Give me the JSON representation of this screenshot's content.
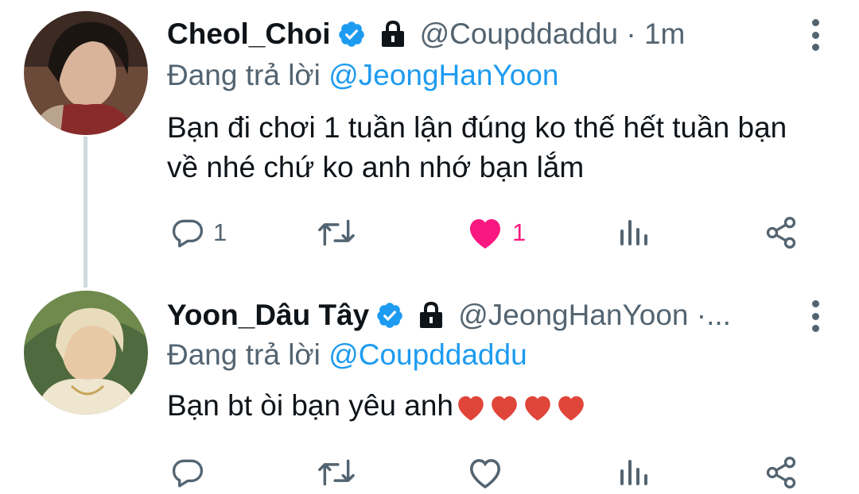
{
  "tweets": [
    {
      "display_name": "Cheol_Choi",
      "handle": "@Coupddaddu",
      "time": "1m",
      "replying_prefix": "Đang trả lời",
      "replying_to": "@JeongHanYoon",
      "text": "Bạn đi chơi 1 tuần lận đúng ko thế hết tuần bạn về nhé chứ ko anh nhớ bạn lắm",
      "reply_count": "1",
      "like_count": "1",
      "liked": true
    },
    {
      "display_name": "Yoon_Dâu Tây",
      "handle": "@JeongHanYoon ·...",
      "replying_prefix": "Đang trả lời",
      "replying_to": "@Coupddaddu",
      "text": "Bạn bt òi bạn yêu anh",
      "liked": false
    }
  ],
  "icons": {
    "verified": "verified-badge-icon",
    "protected": "lock-icon",
    "more": "more-vertical-icon",
    "reply": "reply-icon",
    "retweet": "retweet-icon",
    "like": "heart-icon",
    "views": "analytics-icon",
    "share": "share-icon"
  },
  "colors": {
    "text": "#0f1419",
    "secondary": "#536471",
    "accent": "#1d9bf0",
    "like": "#f91880",
    "thread_line": "#cfd9de"
  }
}
